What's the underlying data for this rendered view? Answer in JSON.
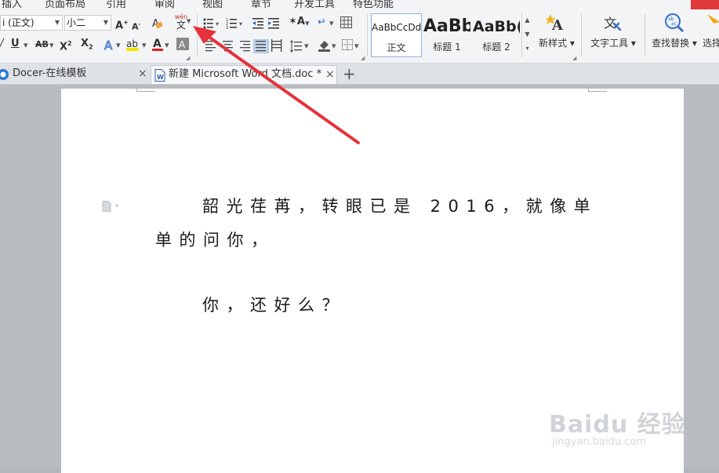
{
  "menu": {
    "tabs": [
      "插入",
      "页面布局",
      "引用",
      "审阅",
      "视图",
      "章节",
      "开发工具",
      "特色功能"
    ]
  },
  "ribbon": {
    "font_name": "i (正文)",
    "font_size": "小二",
    "styles": [
      {
        "sample": "AaBbCcDd",
        "name": "正文"
      },
      {
        "sample": "AaBb",
        "name": "标题 1"
      },
      {
        "sample": "AaBb(",
        "name": "标题 2"
      }
    ],
    "new_style_label": "新样式",
    "text_tools_label": "文字工具",
    "find_replace_label": "查找替换",
    "select_label": "选择",
    "pinyin_top": "wén",
    "pinyin_char": "文",
    "grow_font": "A",
    "shrink_font": "A",
    "bold_hint": "B"
  },
  "tabs": {
    "docer_label": "Docer-在线模板",
    "doc_label": "新建 Microsoft Word 文档.doc *",
    "close_glyph": "×",
    "add_glyph": "+"
  },
  "document": {
    "line1": "韶光荏苒，转眼已是 2016，就像单",
    "line2": "单的问你，",
    "line3": "你，还好么？"
  },
  "watermark": {
    "brand": "Baidu 经验",
    "url": "jingyan.baidu.com"
  },
  "colors": {
    "annotation_arrow": "#e5323b",
    "menu_accent": "#e0393b",
    "ribbon_bg": "#f3f4f6",
    "workspace_bg": "#b9bcc1"
  }
}
